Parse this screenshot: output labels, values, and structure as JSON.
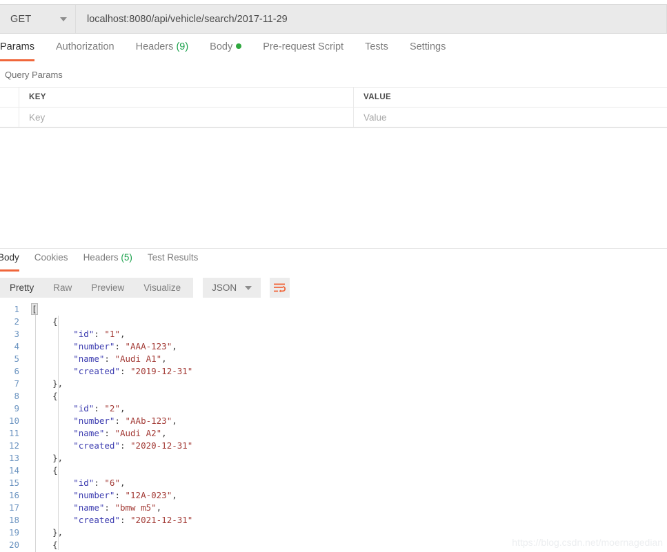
{
  "request": {
    "method": "GET",
    "url": "localhost:8080/api/vehicle/search/2017-11-29",
    "tabs": [
      {
        "label": "Params",
        "active": true
      },
      {
        "label": "Authorization",
        "active": false
      },
      {
        "label": "Headers",
        "count": "(9)",
        "active": false
      },
      {
        "label": "Body",
        "dot": true,
        "active": false
      },
      {
        "label": "Pre-request Script",
        "active": false
      },
      {
        "label": "Tests",
        "active": false
      },
      {
        "label": "Settings",
        "active": false
      }
    ]
  },
  "query_params": {
    "title": "Query Params",
    "columns": [
      "KEY",
      "VALUE"
    ],
    "rows": [
      {
        "key_placeholder": "Key",
        "value_placeholder": "Value"
      }
    ]
  },
  "response": {
    "tabs": [
      {
        "label": "Body",
        "active": true
      },
      {
        "label": "Cookies",
        "active": false
      },
      {
        "label": "Headers",
        "count": "(5)",
        "active": false
      },
      {
        "label": "Test Results",
        "active": false
      }
    ],
    "view_modes": [
      {
        "label": "Pretty",
        "active": true
      },
      {
        "label": "Raw",
        "active": false
      },
      {
        "label": "Preview",
        "active": false
      },
      {
        "label": "Visualize",
        "active": false
      }
    ],
    "format_select": "JSON",
    "wrap_icon": "word-wrap-icon",
    "body_lines": [
      {
        "n": "1",
        "indent": 0,
        "tokens": [
          {
            "t": "punct",
            "v": "[",
            "hl": true
          }
        ]
      },
      {
        "n": "2",
        "indent": 1,
        "tokens": [
          {
            "t": "punct",
            "v": "{"
          }
        ]
      },
      {
        "n": "3",
        "indent": 2,
        "tokens": [
          {
            "t": "key",
            "v": "\"id\""
          },
          {
            "t": "punct",
            "v": ": "
          },
          {
            "t": "str",
            "v": "\"1\""
          },
          {
            "t": "punct",
            "v": ","
          }
        ]
      },
      {
        "n": "4",
        "indent": 2,
        "tokens": [
          {
            "t": "key",
            "v": "\"number\""
          },
          {
            "t": "punct",
            "v": ": "
          },
          {
            "t": "str",
            "v": "\"AAA-123\""
          },
          {
            "t": "punct",
            "v": ","
          }
        ]
      },
      {
        "n": "5",
        "indent": 2,
        "tokens": [
          {
            "t": "key",
            "v": "\"name\""
          },
          {
            "t": "punct",
            "v": ": "
          },
          {
            "t": "str",
            "v": "\"Audi A1\""
          },
          {
            "t": "punct",
            "v": ","
          }
        ]
      },
      {
        "n": "6",
        "indent": 2,
        "tokens": [
          {
            "t": "key",
            "v": "\"created\""
          },
          {
            "t": "punct",
            "v": ": "
          },
          {
            "t": "str",
            "v": "\"2019-12-31\""
          }
        ]
      },
      {
        "n": "7",
        "indent": 1,
        "tokens": [
          {
            "t": "punct",
            "v": "},"
          }
        ]
      },
      {
        "n": "8",
        "indent": 1,
        "tokens": [
          {
            "t": "punct",
            "v": "{"
          }
        ]
      },
      {
        "n": "9",
        "indent": 2,
        "tokens": [
          {
            "t": "key",
            "v": "\"id\""
          },
          {
            "t": "punct",
            "v": ": "
          },
          {
            "t": "str",
            "v": "\"2\""
          },
          {
            "t": "punct",
            "v": ","
          }
        ]
      },
      {
        "n": "10",
        "indent": 2,
        "tokens": [
          {
            "t": "key",
            "v": "\"number\""
          },
          {
            "t": "punct",
            "v": ": "
          },
          {
            "t": "str",
            "v": "\"AAb-123\""
          },
          {
            "t": "punct",
            "v": ","
          }
        ]
      },
      {
        "n": "11",
        "indent": 2,
        "tokens": [
          {
            "t": "key",
            "v": "\"name\""
          },
          {
            "t": "punct",
            "v": ": "
          },
          {
            "t": "str",
            "v": "\"Audi A2\""
          },
          {
            "t": "punct",
            "v": ","
          }
        ]
      },
      {
        "n": "12",
        "indent": 2,
        "tokens": [
          {
            "t": "key",
            "v": "\"created\""
          },
          {
            "t": "punct",
            "v": ": "
          },
          {
            "t": "str",
            "v": "\"2020-12-31\""
          }
        ]
      },
      {
        "n": "13",
        "indent": 1,
        "tokens": [
          {
            "t": "punct",
            "v": "},"
          }
        ]
      },
      {
        "n": "14",
        "indent": 1,
        "tokens": [
          {
            "t": "punct",
            "v": "{"
          }
        ]
      },
      {
        "n": "15",
        "indent": 2,
        "tokens": [
          {
            "t": "key",
            "v": "\"id\""
          },
          {
            "t": "punct",
            "v": ": "
          },
          {
            "t": "str",
            "v": "\"6\""
          },
          {
            "t": "punct",
            "v": ","
          }
        ]
      },
      {
        "n": "16",
        "indent": 2,
        "tokens": [
          {
            "t": "key",
            "v": "\"number\""
          },
          {
            "t": "punct",
            "v": ": "
          },
          {
            "t": "str",
            "v": "\"12A-023\""
          },
          {
            "t": "punct",
            "v": ","
          }
        ]
      },
      {
        "n": "17",
        "indent": 2,
        "tokens": [
          {
            "t": "key",
            "v": "\"name\""
          },
          {
            "t": "punct",
            "v": ": "
          },
          {
            "t": "str",
            "v": "\"bmw m5\""
          },
          {
            "t": "punct",
            "v": ","
          }
        ]
      },
      {
        "n": "18",
        "indent": 2,
        "tokens": [
          {
            "t": "key",
            "v": "\"created\""
          },
          {
            "t": "punct",
            "v": ": "
          },
          {
            "t": "str",
            "v": "\"2021-12-31\""
          }
        ]
      },
      {
        "n": "19",
        "indent": 1,
        "tokens": [
          {
            "t": "punct",
            "v": "},"
          }
        ]
      },
      {
        "n": "20",
        "indent": 1,
        "tokens": [
          {
            "t": "punct",
            "v": "{"
          }
        ]
      }
    ]
  },
  "watermark": "https://blog.csdn.net/moernagedian",
  "colors": {
    "accent_orange": "#f0663b",
    "status_green": "#2fa83f",
    "json_key": "#3c3cb0",
    "json_string": "#a33b36",
    "line_number": "#6a93c0"
  }
}
